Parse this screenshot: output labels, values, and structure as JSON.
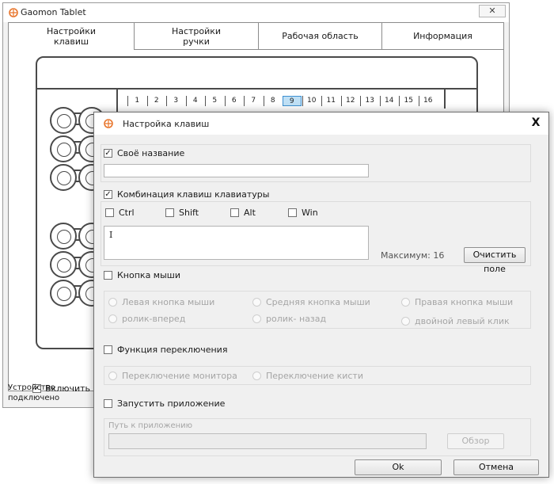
{
  "main_window": {
    "title": "Gaomon Tablet",
    "close_glyph": "✕",
    "tabs": [
      {
        "label": "Настройки\nклавиш"
      },
      {
        "label": "Настройки\nручки"
      },
      {
        "label": "Рабочая область"
      },
      {
        "label": "Информация"
      }
    ],
    "key_numbers": [
      "1",
      "2",
      "3",
      "4",
      "5",
      "6",
      "7",
      "8",
      "9",
      "10",
      "11",
      "12",
      "13",
      "14",
      "15",
      "16"
    ],
    "selected_key": "9",
    "enable_checkbox_label": "Включить эксп",
    "status_line1": "Устройство",
    "status_line2": "подключено"
  },
  "dialog": {
    "title": "Настройка клавиш",
    "close_glyph": "X",
    "custom_name": {
      "label": "Своё название",
      "checked": true,
      "value": ""
    },
    "keyboard_combo": {
      "label": "Комбинация клавиш клавиатуры",
      "checked": true,
      "modifiers": [
        {
          "label": "Ctrl"
        },
        {
          "label": "Shift"
        },
        {
          "label": "Alt"
        },
        {
          "label": "Win"
        }
      ],
      "input_value": "I",
      "max_label": "Максимум: 16",
      "clear_button": "Очистить поле"
    },
    "mouse_button": {
      "label": "Кнопка мыши",
      "options": [
        {
          "label": "Левая кнопка мыши"
        },
        {
          "label": "Средняя кнопка мыши"
        },
        {
          "label": "Правая кнопка мыши"
        },
        {
          "label": "ролик-вперед"
        },
        {
          "label": "ролик- назад"
        },
        {
          "label": "двойной левый клик"
        }
      ]
    },
    "switch_function": {
      "label": "Функция переключения",
      "options": [
        {
          "label": "Переключение монитора"
        },
        {
          "label": "Переключение кисти"
        }
      ]
    },
    "launch_app": {
      "label": "Запустить приложение",
      "path_label": "Путь к приложению",
      "browse_button": "Обзор"
    },
    "ok_button": "Ok",
    "cancel_button": "Отмена"
  },
  "colors": {
    "accent_icon": "#e8742a",
    "selected_key_fill": "#bfe0f5"
  }
}
